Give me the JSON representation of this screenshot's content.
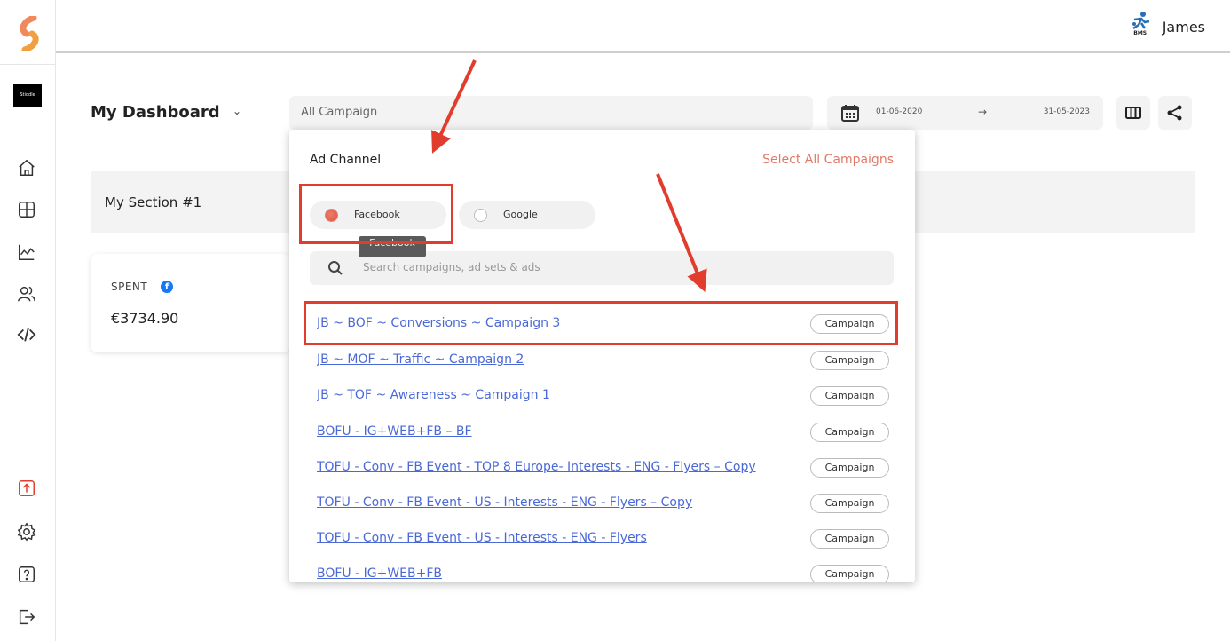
{
  "app": {
    "brand_label": "Stiddle"
  },
  "user": {
    "name": "James",
    "logo_text": "BMS"
  },
  "dashboard": {
    "title": "My Dashboard",
    "campaign_select_value": "All Campaign",
    "date_from": "01-06-2020",
    "date_arrow": "→",
    "date_to": "31-05-2023"
  },
  "section": {
    "title": "My Section #1"
  },
  "card": {
    "label": "SPENT",
    "value": "€3734.90"
  },
  "dropdown": {
    "title": "Ad Channel",
    "select_all": "Select All Campaigns",
    "channels": [
      {
        "label": "Facebook",
        "selected": true
      },
      {
        "label": "Google",
        "selected": false
      }
    ],
    "tooltip": "Facebook",
    "search_placeholder": "Search campaigns, ad sets & ads",
    "items": [
      {
        "name": "JB ~ BOF ~ Conversions ~ Campaign 3",
        "type": "Campaign"
      },
      {
        "name": "JB ~ MOF ~ Traffic ~ Campaign 2",
        "type": "Campaign"
      },
      {
        "name": "JB ~ TOF ~ Awareness ~ Campaign 1",
        "type": "Campaign"
      },
      {
        "name": "BOFU - IG+WEB+FB – BF",
        "type": "Campaign"
      },
      {
        "name": "TOFU - Conv - FB Event - TOP 8 Europe- Interests - ENG - Flyers – Copy",
        "type": "Campaign"
      },
      {
        "name": "TOFU - Conv - FB Event - US - Interests - ENG - Flyers – Copy",
        "type": "Campaign"
      },
      {
        "name": "TOFU - Conv - FB Event - US - Interests - ENG - Flyers",
        "type": "Campaign"
      },
      {
        "name": "BOFU - IG+WEB+FB",
        "type": "Campaign"
      }
    ]
  },
  "colors": {
    "accent": "#e07a68",
    "link": "#4b69d6",
    "annotation": "#e23d2c",
    "facebook": "#1877f2"
  }
}
